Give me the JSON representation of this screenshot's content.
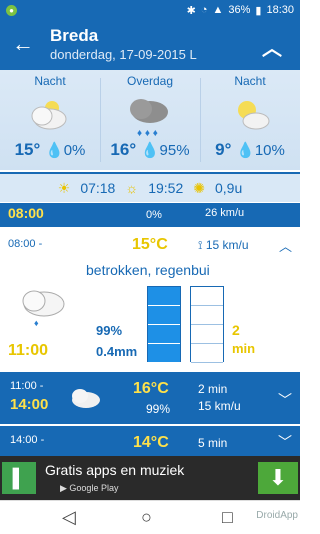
{
  "status": {
    "battery": "36%",
    "time": "18:30",
    "notification_icon": "android-app-icon"
  },
  "appbar": {
    "city": "Breda",
    "date": "donderdag, 17-09-2015 L"
  },
  "forecast": [
    {
      "period": "Nacht",
      "temp": "15°",
      "precip": "0%"
    },
    {
      "period": "Overdag",
      "temp": "16°",
      "precip": "95%"
    },
    {
      "period": "Nacht",
      "temp": "9°",
      "precip": "10%"
    }
  ],
  "sun": {
    "sunrise": "07:18",
    "sunset": "19:52",
    "sunshine": "0,9u"
  },
  "rows": {
    "first": {
      "time": "08:00",
      "precip": "0%",
      "wind": "26 km/u"
    },
    "expanded": {
      "range": "08:00 -",
      "temp": "15°C",
      "wind": "15 km/u",
      "description": "betrokken, regenbui",
      "end": "11:00",
      "precip_prob": "99%",
      "precip_mm": "0.4mm",
      "sun_min": "2",
      "sun_unit": "min"
    },
    "second": {
      "range": "11:00 -",
      "end": "14:00",
      "temp": "16°C",
      "precip": "99%",
      "sun": "2 min",
      "wind": "15 km/u"
    },
    "third": {
      "range": "14:00 -",
      "temp": "14°C",
      "sun": "5 min"
    }
  },
  "ad": {
    "title": "Gratis apps en muziek",
    "subtitle": "Google Play"
  },
  "watermark": "DroidApp"
}
